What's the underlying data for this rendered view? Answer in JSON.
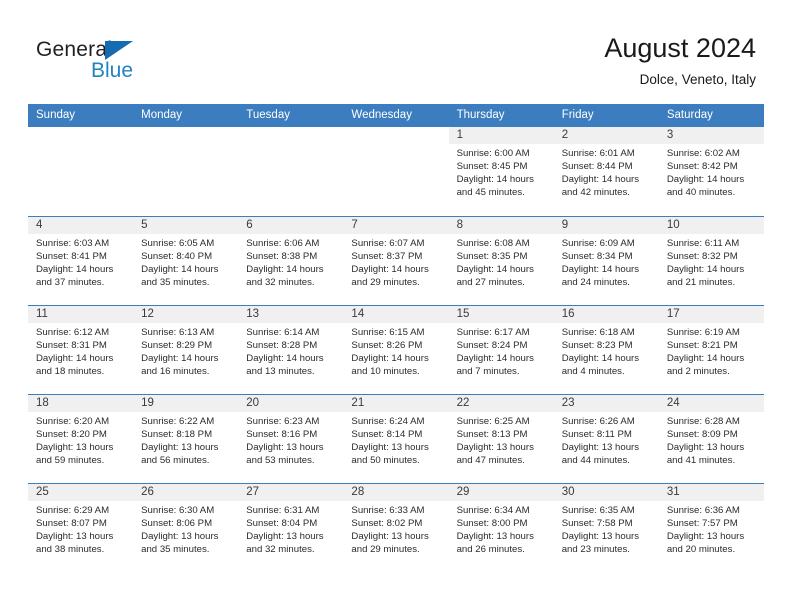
{
  "brand": {
    "name_part1": "General",
    "name_part2": "Blue",
    "triangle_color": "#156bb1",
    "blue_color": "#2183c4"
  },
  "header": {
    "title": "August 2024",
    "subtitle": "Dolce, Veneto, Italy"
  },
  "colors": {
    "header_blue": "#3b7dbf",
    "daynum_band": "#f0f0f0",
    "text": "#2b2b2b"
  },
  "weekday_headers": [
    "Sunday",
    "Monday",
    "Tuesday",
    "Wednesday",
    "Thursday",
    "Friday",
    "Saturday"
  ],
  "weeks": [
    [
      {
        "day": "",
        "lines": []
      },
      {
        "day": "",
        "lines": []
      },
      {
        "day": "",
        "lines": []
      },
      {
        "day": "",
        "lines": []
      },
      {
        "day": "1",
        "lines": [
          "Sunrise: 6:00 AM",
          "Sunset: 8:45 PM",
          "Daylight: 14 hours",
          "and 45 minutes."
        ]
      },
      {
        "day": "2",
        "lines": [
          "Sunrise: 6:01 AM",
          "Sunset: 8:44 PM",
          "Daylight: 14 hours",
          "and 42 minutes."
        ]
      },
      {
        "day": "3",
        "lines": [
          "Sunrise: 6:02 AM",
          "Sunset: 8:42 PM",
          "Daylight: 14 hours",
          "and 40 minutes."
        ]
      }
    ],
    [
      {
        "day": "4",
        "lines": [
          "Sunrise: 6:03 AM",
          "Sunset: 8:41 PM",
          "Daylight: 14 hours",
          "and 37 minutes."
        ]
      },
      {
        "day": "5",
        "lines": [
          "Sunrise: 6:05 AM",
          "Sunset: 8:40 PM",
          "Daylight: 14 hours",
          "and 35 minutes."
        ]
      },
      {
        "day": "6",
        "lines": [
          "Sunrise: 6:06 AM",
          "Sunset: 8:38 PM",
          "Daylight: 14 hours",
          "and 32 minutes."
        ]
      },
      {
        "day": "7",
        "lines": [
          "Sunrise: 6:07 AM",
          "Sunset: 8:37 PM",
          "Daylight: 14 hours",
          "and 29 minutes."
        ]
      },
      {
        "day": "8",
        "lines": [
          "Sunrise: 6:08 AM",
          "Sunset: 8:35 PM",
          "Daylight: 14 hours",
          "and 27 minutes."
        ]
      },
      {
        "day": "9",
        "lines": [
          "Sunrise: 6:09 AM",
          "Sunset: 8:34 PM",
          "Daylight: 14 hours",
          "and 24 minutes."
        ]
      },
      {
        "day": "10",
        "lines": [
          "Sunrise: 6:11 AM",
          "Sunset: 8:32 PM",
          "Daylight: 14 hours",
          "and 21 minutes."
        ]
      }
    ],
    [
      {
        "day": "11",
        "lines": [
          "Sunrise: 6:12 AM",
          "Sunset: 8:31 PM",
          "Daylight: 14 hours",
          "and 18 minutes."
        ]
      },
      {
        "day": "12",
        "lines": [
          "Sunrise: 6:13 AM",
          "Sunset: 8:29 PM",
          "Daylight: 14 hours",
          "and 16 minutes."
        ]
      },
      {
        "day": "13",
        "lines": [
          "Sunrise: 6:14 AM",
          "Sunset: 8:28 PM",
          "Daylight: 14 hours",
          "and 13 minutes."
        ]
      },
      {
        "day": "14",
        "lines": [
          "Sunrise: 6:15 AM",
          "Sunset: 8:26 PM",
          "Daylight: 14 hours",
          "and 10 minutes."
        ]
      },
      {
        "day": "15",
        "lines": [
          "Sunrise: 6:17 AM",
          "Sunset: 8:24 PM",
          "Daylight: 14 hours",
          "and 7 minutes."
        ]
      },
      {
        "day": "16",
        "lines": [
          "Sunrise: 6:18 AM",
          "Sunset: 8:23 PM",
          "Daylight: 14 hours",
          "and 4 minutes."
        ]
      },
      {
        "day": "17",
        "lines": [
          "Sunrise: 6:19 AM",
          "Sunset: 8:21 PM",
          "Daylight: 14 hours",
          "and 2 minutes."
        ]
      }
    ],
    [
      {
        "day": "18",
        "lines": [
          "Sunrise: 6:20 AM",
          "Sunset: 8:20 PM",
          "Daylight: 13 hours",
          "and 59 minutes."
        ]
      },
      {
        "day": "19",
        "lines": [
          "Sunrise: 6:22 AM",
          "Sunset: 8:18 PM",
          "Daylight: 13 hours",
          "and 56 minutes."
        ]
      },
      {
        "day": "20",
        "lines": [
          "Sunrise: 6:23 AM",
          "Sunset: 8:16 PM",
          "Daylight: 13 hours",
          "and 53 minutes."
        ]
      },
      {
        "day": "21",
        "lines": [
          "Sunrise: 6:24 AM",
          "Sunset: 8:14 PM",
          "Daylight: 13 hours",
          "and 50 minutes."
        ]
      },
      {
        "day": "22",
        "lines": [
          "Sunrise: 6:25 AM",
          "Sunset: 8:13 PM",
          "Daylight: 13 hours",
          "and 47 minutes."
        ]
      },
      {
        "day": "23",
        "lines": [
          "Sunrise: 6:26 AM",
          "Sunset: 8:11 PM",
          "Daylight: 13 hours",
          "and 44 minutes."
        ]
      },
      {
        "day": "24",
        "lines": [
          "Sunrise: 6:28 AM",
          "Sunset: 8:09 PM",
          "Daylight: 13 hours",
          "and 41 minutes."
        ]
      }
    ],
    [
      {
        "day": "25",
        "lines": [
          "Sunrise: 6:29 AM",
          "Sunset: 8:07 PM",
          "Daylight: 13 hours",
          "and 38 minutes."
        ]
      },
      {
        "day": "26",
        "lines": [
          "Sunrise: 6:30 AM",
          "Sunset: 8:06 PM",
          "Daylight: 13 hours",
          "and 35 minutes."
        ]
      },
      {
        "day": "27",
        "lines": [
          "Sunrise: 6:31 AM",
          "Sunset: 8:04 PM",
          "Daylight: 13 hours",
          "and 32 minutes."
        ]
      },
      {
        "day": "28",
        "lines": [
          "Sunrise: 6:33 AM",
          "Sunset: 8:02 PM",
          "Daylight: 13 hours",
          "and 29 minutes."
        ]
      },
      {
        "day": "29",
        "lines": [
          "Sunrise: 6:34 AM",
          "Sunset: 8:00 PM",
          "Daylight: 13 hours",
          "and 26 minutes."
        ]
      },
      {
        "day": "30",
        "lines": [
          "Sunrise: 6:35 AM",
          "Sunset: 7:58 PM",
          "Daylight: 13 hours",
          "and 23 minutes."
        ]
      },
      {
        "day": "31",
        "lines": [
          "Sunrise: 6:36 AM",
          "Sunset: 7:57 PM",
          "Daylight: 13 hours",
          "and 20 minutes."
        ]
      }
    ]
  ]
}
